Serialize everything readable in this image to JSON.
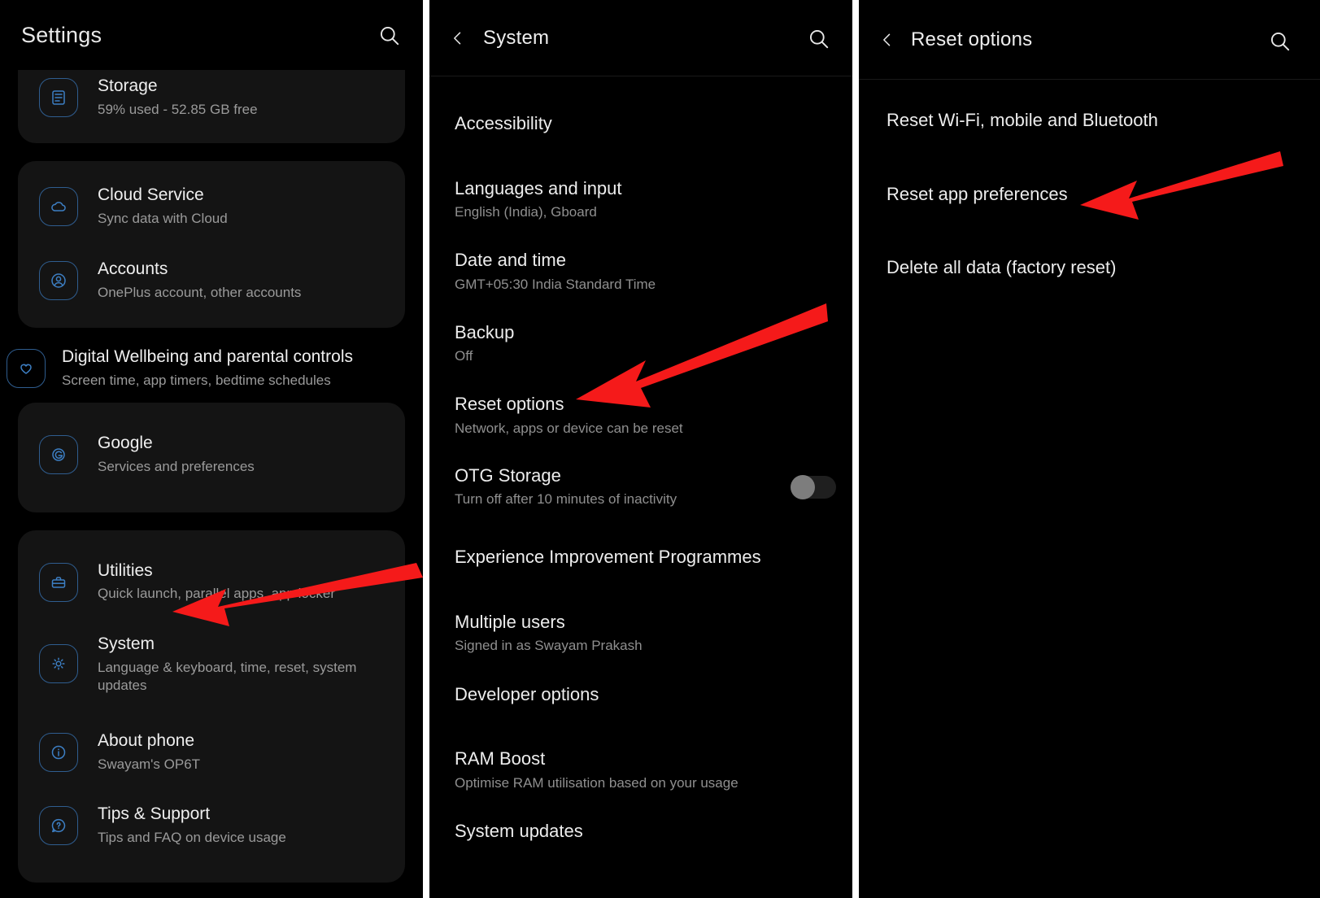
{
  "panels": {
    "settings": {
      "appbar": {
        "title": "Settings",
        "search_icon": "search-icon"
      },
      "groups": [
        {
          "id": "storage-card",
          "clipped": true,
          "items": [
            {
              "icon": "storage-icon",
              "title": "Storage",
              "subtitle": "59% used - 52.85 GB free"
            }
          ]
        },
        {
          "id": "accounts-card",
          "clipped": false,
          "items": [
            {
              "icon": "cloud-icon",
              "title": "Cloud Service",
              "subtitle": "Sync data with Cloud"
            },
            {
              "icon": "account-icon",
              "title": "Accounts",
              "subtitle": "OnePlus account, other accounts"
            }
          ]
        },
        {
          "id": "wellbeing-row",
          "bare": true,
          "items": [
            {
              "icon": "heart-icon",
              "title": "Digital Wellbeing and parental controls",
              "subtitle": "Screen time, app timers, bedtime schedules"
            }
          ]
        },
        {
          "id": "google-card",
          "clipped": false,
          "items": [
            {
              "icon": "google-icon",
              "title": "Google",
              "subtitle": "Services and preferences"
            }
          ]
        },
        {
          "id": "system-card",
          "clipped": false,
          "items": [
            {
              "icon": "toolbox-icon",
              "title": "Utilities",
              "subtitle": "Quick launch, parallel apps, app locker"
            },
            {
              "icon": "gear-icon",
              "title": "System",
              "subtitle": "Language & keyboard, time, reset, system updates"
            },
            {
              "icon": "info-icon",
              "title": "About phone",
              "subtitle": "Swayam's OP6T"
            },
            {
              "icon": "help-icon",
              "title": "Tips & Support",
              "subtitle": "Tips and FAQ on device usage"
            }
          ]
        }
      ],
      "arrow": {
        "points_to": "System"
      }
    },
    "system": {
      "appbar": {
        "title": "System",
        "back_icon": "chevron-left-icon",
        "search_icon": "search-icon"
      },
      "items": [
        {
          "title": "Accessibility",
          "subtitle": ""
        },
        {
          "title": "Languages and input",
          "subtitle": "English (India), Gboard"
        },
        {
          "title": "Date and time",
          "subtitle": "GMT+05:30 India Standard Time"
        },
        {
          "title": "Backup",
          "subtitle": "Off"
        },
        {
          "title": "Reset options",
          "subtitle": "Network, apps or device can be reset"
        },
        {
          "title": "OTG Storage",
          "subtitle": "Turn off after 10 minutes of inactivity",
          "toggle": "off"
        },
        {
          "title": "Experience Improvement Programmes",
          "subtitle": ""
        },
        {
          "title": "Multiple users",
          "subtitle": "Signed in as Swayam Prakash"
        },
        {
          "title": "Developer options",
          "subtitle": ""
        },
        {
          "title": "RAM Boost",
          "subtitle": "Optimise RAM utilisation based on your usage"
        },
        {
          "title": "System updates",
          "subtitle": ""
        }
      ],
      "arrow": {
        "points_to": "Reset options"
      }
    },
    "reset": {
      "appbar": {
        "title": "Reset options",
        "back_icon": "chevron-left-icon",
        "search_icon": "search-icon"
      },
      "items": [
        {
          "title": "Reset Wi-Fi, mobile and Bluetooth"
        },
        {
          "title": "Reset app preferences"
        },
        {
          "title": "Delete all data (factory reset)"
        }
      ],
      "arrow": {
        "points_to": "Reset app preferences"
      }
    }
  },
  "colors": {
    "background": "#000000",
    "card": "#141414",
    "icon_accent": "#3d7fc4",
    "icon_border": "#2f5d8f",
    "title_text": "#efefef",
    "subtitle_text": "#9a9a9a",
    "annotation_arrow": "#f51a1a",
    "panel_divider": "#ffffff",
    "toggle_track": "#1f1f1f",
    "toggle_knob": "#7d7d7d"
  }
}
